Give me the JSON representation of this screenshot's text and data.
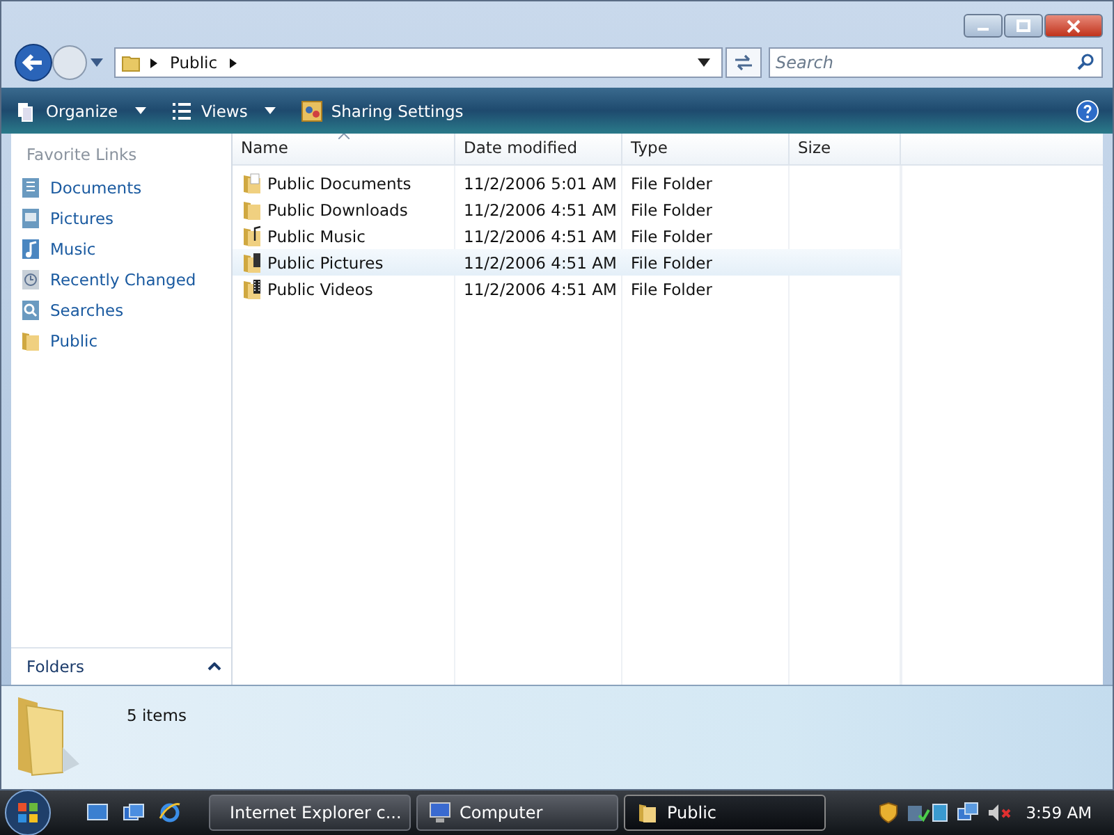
{
  "window": {
    "address": [
      "Public"
    ],
    "search": {
      "placeholder": "Search"
    }
  },
  "toolbar": [
    {
      "label": "Organize",
      "kind": "menu"
    },
    {
      "label": "Views",
      "kind": "menu"
    },
    {
      "label": "Sharing Settings",
      "kind": "action"
    }
  ],
  "sidebar": {
    "title": "Favorite Links",
    "items": [
      {
        "label": "Documents"
      },
      {
        "label": "Pictures"
      },
      {
        "label": "Music"
      },
      {
        "label": "Recently Changed"
      },
      {
        "label": "Searches"
      },
      {
        "label": "Public"
      }
    ],
    "folders": {
      "label": "Folders",
      "expanded": false
    }
  },
  "table": {
    "columns": [
      "Name",
      "Date modified",
      "Type",
      "Size"
    ],
    "rows": [
      {
        "name": "Public Documents",
        "date": "11/2/2006 5:01 AM",
        "type": "File Folder",
        "hovered": false
      },
      {
        "name": "Public Downloads",
        "date": "11/2/2006 4:51 AM",
        "type": "File Folder",
        "hovered": false
      },
      {
        "name": "Public Music",
        "date": "11/2/2006 4:51 AM",
        "type": "File Folder",
        "hovered": false
      },
      {
        "name": "Public Pictures",
        "date": "11/2/2006 4:51 AM",
        "type": "File Folder",
        "hovered": true
      },
      {
        "name": "Public Videos",
        "date": "11/2/2006 4:51 AM",
        "type": "File Folder",
        "hovered": false
      }
    ]
  },
  "status": {
    "count": "5 items"
  },
  "taskbar": {
    "tasks": [
      {
        "label": "Internet Explorer c...",
        "selected": false
      },
      {
        "label": "Computer",
        "selected": false
      },
      {
        "label": "Public",
        "selected": true
      }
    ],
    "clock": "3:59 AM"
  }
}
